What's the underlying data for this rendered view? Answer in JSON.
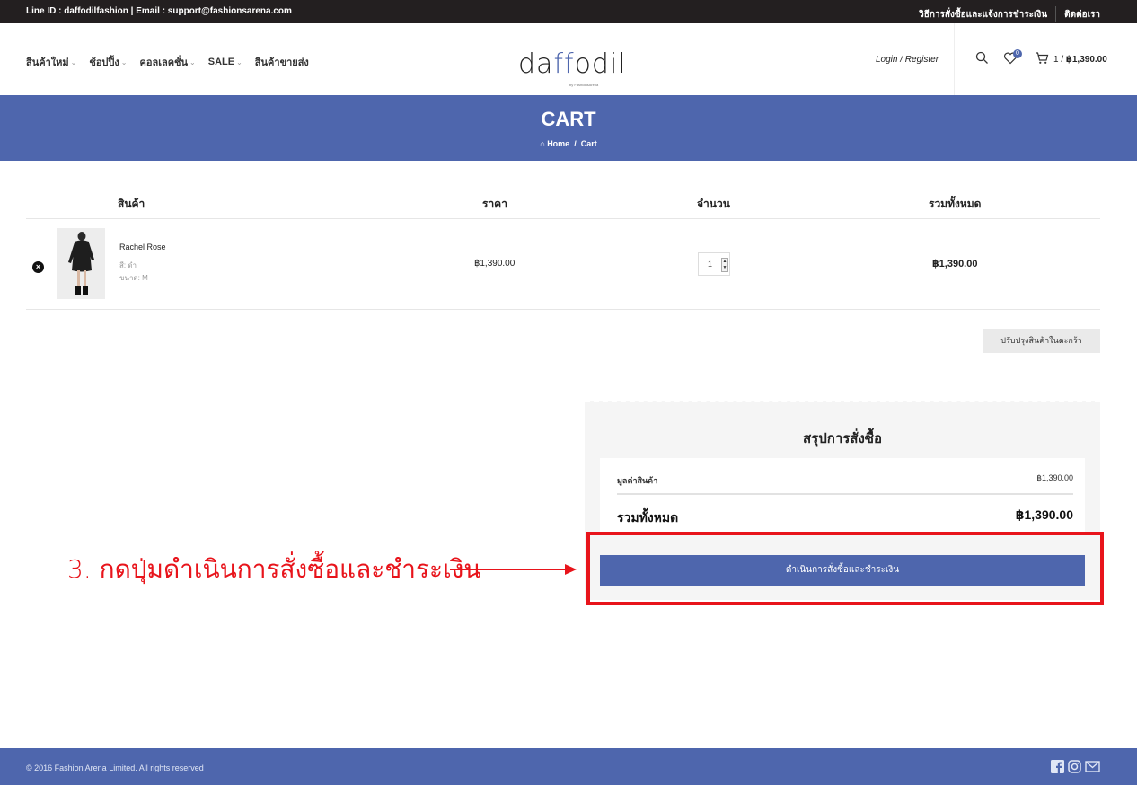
{
  "topbar": {
    "contact": "Line ID : daffodilfashion | Email : support@fashionsarena.com",
    "how_to_order": "วิธีการสั่งซื้อและแจ้งการชำระเงิน",
    "contact_us": "ติดต่อเรา"
  },
  "nav": {
    "items": [
      {
        "label": "สินค้าใหม่",
        "has_dropdown": true
      },
      {
        "label": "ช้อปปิ้ง",
        "has_dropdown": true
      },
      {
        "label": "คอลเลคชั่น",
        "has_dropdown": true
      },
      {
        "label": "SALE",
        "has_dropdown": true
      },
      {
        "label": "สินค้าขายส่ง",
        "has_dropdown": false
      }
    ]
  },
  "logo": {
    "word_start": "da",
    "word_ff": "ff",
    "word_end": "odil",
    "byline": "by FashionsArena"
  },
  "header": {
    "login_register": "Login / Register",
    "wishlist_count": "0",
    "cart_count": "1 /",
    "cart_total": "฿1,390.00"
  },
  "banner": {
    "title": "CART",
    "crumb_home": "Home",
    "crumb_sep": "/",
    "crumb_current": "Cart"
  },
  "cart_table": {
    "headers": {
      "product": "สินค้า",
      "price": "ราคา",
      "quantity": "จำนวน",
      "total": "รวมทั้งหมด"
    },
    "rows": [
      {
        "name": "Rachel Rose",
        "color": "สี: ดำ",
        "size": "ขนาด: M",
        "price": "฿1,390.00",
        "quantity": "1",
        "total": "฿1,390.00"
      }
    ],
    "update_button": "ปรับปรุงสินค้าในตะกร้า"
  },
  "summary": {
    "title": "สรุปการสั่งซื้อ",
    "subtotal_label": "มูลค่าสินค้า",
    "subtotal_value": "฿1,390.00",
    "total_label": "รวมทั้งหมด",
    "total_value": "฿1,390.00",
    "checkout_button": "ดำเนินการสั่งซื้อและชำระเงิน"
  },
  "annotation": {
    "text": "3. กดปุ่มดำเนินการสั่งซื้อและชำระเงิน",
    "color": "#e8141b"
  },
  "footer": {
    "copyright": "© 2016 Fashion Arena Limited. All rights reserved"
  },
  "colors": {
    "brand": "#4e66ad",
    "topbar": "#231f20",
    "highlight": "#e8141b"
  }
}
